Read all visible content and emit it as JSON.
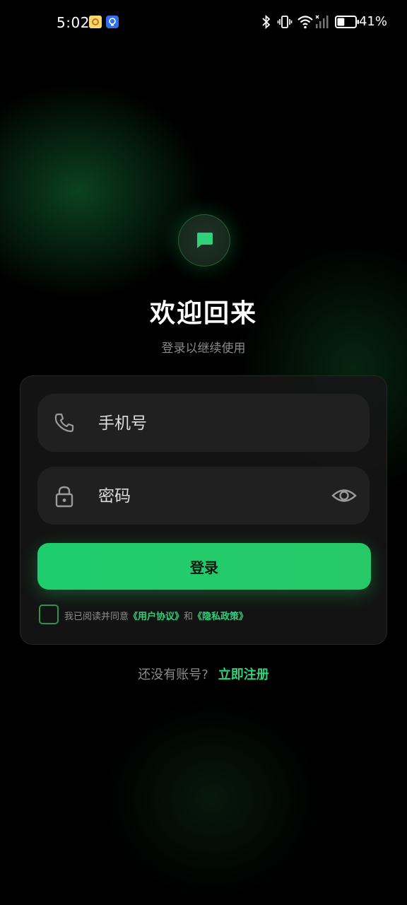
{
  "status_bar": {
    "time": "5:02",
    "battery_percent": "41%",
    "battery_level": 0.41,
    "icons": [
      "bluetooth-icon",
      "vibrate-icon",
      "wifi-icon",
      "signal-icon",
      "battery-icon"
    ]
  },
  "login": {
    "title": "欢迎回来",
    "subtitle": "登录以继续使用",
    "phone_placeholder": "手机号",
    "phone_value": "",
    "password_placeholder": "密码",
    "password_value": "",
    "login_button": "登录",
    "agreement": {
      "checked": false,
      "prefix": "我已阅读并同意",
      "user_agreement": "《用户协议》",
      "conjunction": "和",
      "privacy_policy": "《隐私政策》"
    },
    "footer_question": "还没有账号?",
    "register_link": "立即注册"
  },
  "colors": {
    "accent": "#22c96a",
    "background": "#000000",
    "card": "#161616",
    "field": "#202020"
  }
}
